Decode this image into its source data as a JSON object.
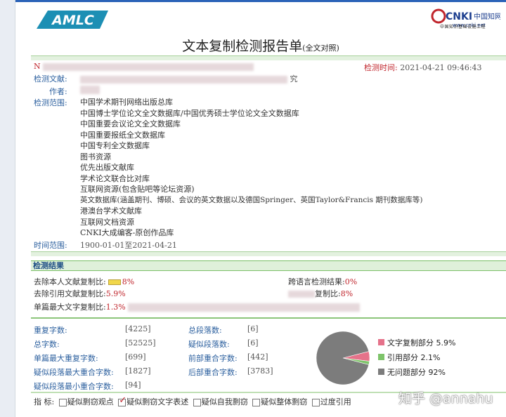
{
  "logo_left": "AMLC",
  "cnki_logo": {
    "brand": "CNKI",
    "site": "www.cnki.net",
    "cn": "中国知网",
    "subtitle": "中国知识基础设施工程"
  },
  "title": "文本复制检测报告单",
  "title_suffix": "(全文对照)",
  "info": {
    "no_prefix": "N",
    "check_time_label": "检测时间:",
    "check_time": "2021-04-21 09:46:43",
    "doc_label": "检测文献:",
    "doc_tail": "究",
    "author_label": "作者:",
    "scope_label": "检测范围:",
    "scope": [
      "中国学术期刊网络出版总库",
      "中国博士学位论文全文数据库/中国优秀硕士学位论文全文数据库",
      "中国重要会议论文全文数据库",
      "中国重要报纸全文数据库",
      "中国专利全文数据库",
      "图书资源",
      "优先出版文献库",
      "学术论文联合比对库",
      "互联网资源(包含贴吧等论坛资源)",
      "英文数据库(涵盖期刊、博硕、会议的英文数据以及德国Springer、英国Taylor&Francis 期刊数据库等)",
      "港澳台学术文献库",
      "互联网文档资源",
      "CNKI大成编客-原创作品库"
    ],
    "time_range_label": "时间范围:",
    "time_range": "1900-01-01至2021-04-21"
  },
  "results": {
    "section_title": "检测结果",
    "self_label": "去除本人文献复制比:",
    "self_value": "8%",
    "cross_label": "跨语言检测结果:",
    "cross_value": "0%",
    "quote_label": "去除引用文献复制比:",
    "quote_value": "5.9%",
    "total_label": "复制比:",
    "total_value": "8%",
    "max_label": "单篇最大文字复制比:",
    "max_value": "1.3%"
  },
  "stats": {
    "rep_chars_label": "重复字数:",
    "rep_chars": "[4225]",
    "total_paras_label": "总段落数:",
    "total_paras": "[6]",
    "total_chars_label": "总字数:",
    "total_chars": "[52525]",
    "sus_paras_label": "疑似段落数:",
    "sus_paras": "[6]",
    "max_rep_label": "单篇最大重复字数:",
    "max_rep": "[699]",
    "front_label": "前部重合字数:",
    "front": "[442]",
    "max_para_label": "疑似段落最大重合字数:",
    "max_para": "[1827]",
    "back_label": "后部重合字数:",
    "back": "[3783]",
    "min_para_label": "疑似段落最小重合字数:",
    "min_para": "[94]"
  },
  "legend": [
    {
      "label": "文字复制部分",
      "value": "5.9%",
      "color": "#e5728a"
    },
    {
      "label": "引用部分",
      "value": "2.1%",
      "color": "#7ec46a"
    },
    {
      "label": "无问题部分",
      "value": "92%",
      "color": "#7c7c7c"
    }
  ],
  "chart_data": {
    "type": "pie",
    "categories": [
      "文字复制部分",
      "引用部分",
      "无问题部分"
    ],
    "values": [
      5.9,
      2.1,
      92
    ],
    "colors": [
      "#e5728a",
      "#7ec46a",
      "#7c7c7c"
    ]
  },
  "indicators": {
    "label": "指  标:",
    "items": [
      {
        "label": "疑似剽窃观点",
        "checked": false
      },
      {
        "label": "疑似剽窃文字表述",
        "checked": true
      },
      {
        "label": "疑似自我剽窃",
        "checked": false
      },
      {
        "label": "疑似整体剽窃",
        "checked": false
      },
      {
        "label": "过度引用",
        "checked": false
      }
    ]
  },
  "watermark": "知乎 @annahu"
}
